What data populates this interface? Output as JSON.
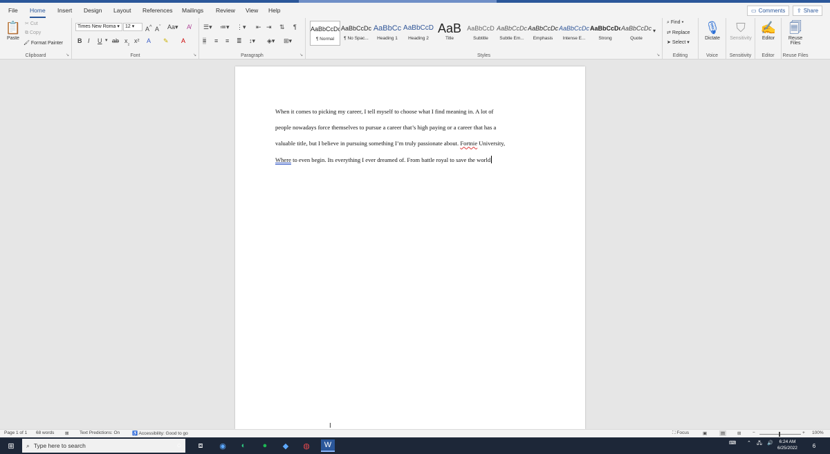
{
  "menu": {
    "tabs": [
      "File",
      "Home",
      "Insert",
      "Design",
      "Layout",
      "References",
      "Mailings",
      "Review",
      "View",
      "Help"
    ],
    "active_tab": "Home",
    "comments_label": "Comments",
    "share_label": "Share"
  },
  "ribbon": {
    "clipboard": {
      "paste": "Paste",
      "cut": "Cut",
      "copy": "Copy",
      "format_painter": "Format Painter",
      "label": "Clipboard"
    },
    "font": {
      "family": "Times New Roma",
      "size": "12",
      "label": "Font"
    },
    "paragraph": {
      "label": "Paragraph"
    },
    "styles": {
      "label": "Styles",
      "items": [
        {
          "preview": "AaBbCcDc",
          "name": "¶ Normal"
        },
        {
          "preview": "AaBbCcDc",
          "name": "¶ No Spac..."
        },
        {
          "preview": "AaBbCc",
          "name": "Heading 1"
        },
        {
          "preview": "AaBbCcD",
          "name": "Heading 2"
        },
        {
          "preview": "AaB",
          "name": "Title"
        },
        {
          "preview": "AaBbCcD",
          "name": "Subtitle"
        },
        {
          "preview": "AaBbCcDc",
          "name": "Subtle Em..."
        },
        {
          "preview": "AaBbCcDc",
          "name": "Emphasis"
        },
        {
          "preview": "AaBbCcDc",
          "name": "Intense E..."
        },
        {
          "preview": "AaBbCcDc",
          "name": "Strong"
        },
        {
          "preview": "AaBbCcDc",
          "name": "Quote"
        }
      ]
    },
    "editing": {
      "find": "Find",
      "replace": "Replace",
      "select": "Select",
      "label": "Editing"
    },
    "voice": {
      "dictate": "Dictate",
      "label": "Voice"
    },
    "sensitivity": {
      "button": "Sensitivity",
      "label": "Sensitivity"
    },
    "editor": {
      "button": "Editor",
      "label": "Editor"
    },
    "reuse": {
      "button_line1": "Reuse",
      "button_line2": "Files",
      "label": "Reuse Files"
    }
  },
  "document": {
    "line1": "When it comes to picking my career, I tell myself to choose what I find meaning in. A lot of",
    "line2": "people nowadays force themselves to pursue a career that’s high paying or a career that has a",
    "line3_pre": "valuable title, but I believe in pursuing something I’m truly passionate about.",
    "line3_err": "Fortnie",
    "line3_post": "University,",
    "line4_gram": "Where",
    "line4_post": "to even begin. Its everything I ever dreamed of. From battle royal to save the world"
  },
  "status": {
    "page": "Page 1 of 1",
    "words": "68 words",
    "predictions": "Text Predictions: On",
    "accessibility": "Accessibility: Good to go",
    "focus": "Focus",
    "zoom": "100%"
  },
  "taskbar": {
    "search_placeholder": "Type here to search",
    "time": "6:24 AM",
    "date": "6/25/2022",
    "notification_count": "6"
  },
  "colors": {
    "accent": "#2b579a",
    "taskbar": "#1d2738",
    "spell_error": "#d33",
    "grammar": "#3b5ec6"
  }
}
